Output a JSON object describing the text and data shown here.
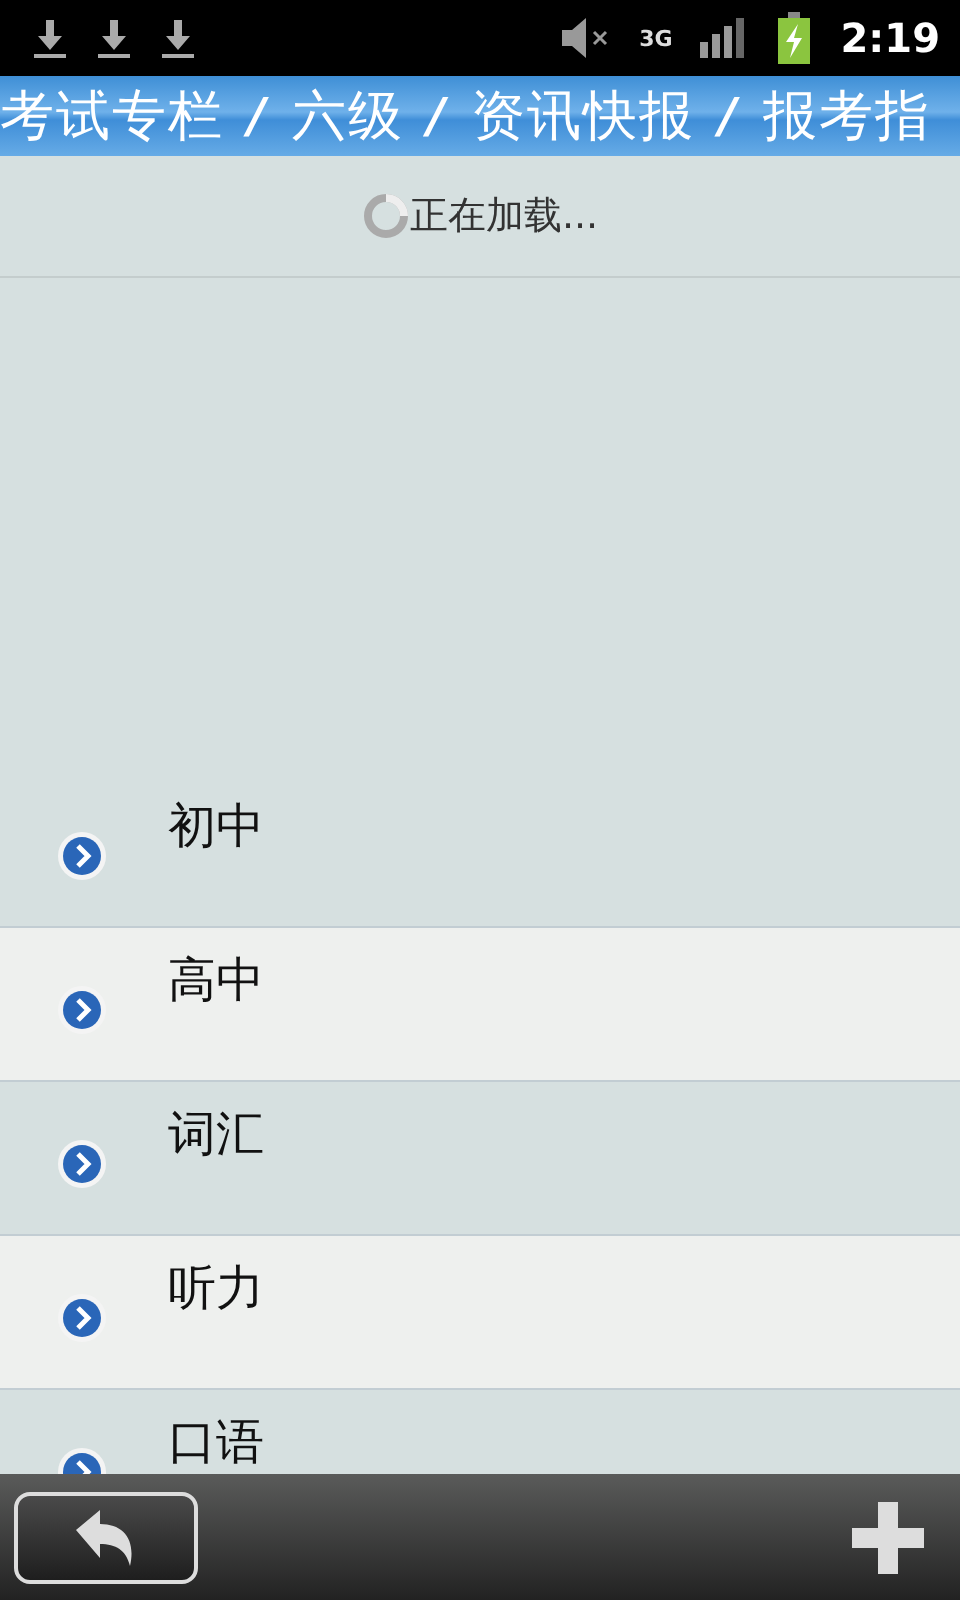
{
  "status_bar": {
    "notifications": [
      {
        "kind": "download"
      },
      {
        "kind": "download"
      },
      {
        "kind": "download"
      }
    ],
    "network": "3G",
    "time": "2:19"
  },
  "breadcrumb": [
    {
      "kind": "segment",
      "text": "考试专栏"
    },
    {
      "kind": "separator",
      "text": "/"
    },
    {
      "kind": "segment",
      "text": "六级"
    },
    {
      "kind": "separator",
      "text": "/"
    },
    {
      "kind": "segment",
      "text": "资讯快报"
    },
    {
      "kind": "separator",
      "text": "/"
    },
    {
      "kind": "segment",
      "text": "报考指"
    }
  ],
  "loading": {
    "text": "正在加载..."
  },
  "items": [
    {
      "label": "初中"
    },
    {
      "label": "高中"
    },
    {
      "label": "词汇"
    },
    {
      "label": "听力"
    },
    {
      "label": "口语"
    }
  ]
}
